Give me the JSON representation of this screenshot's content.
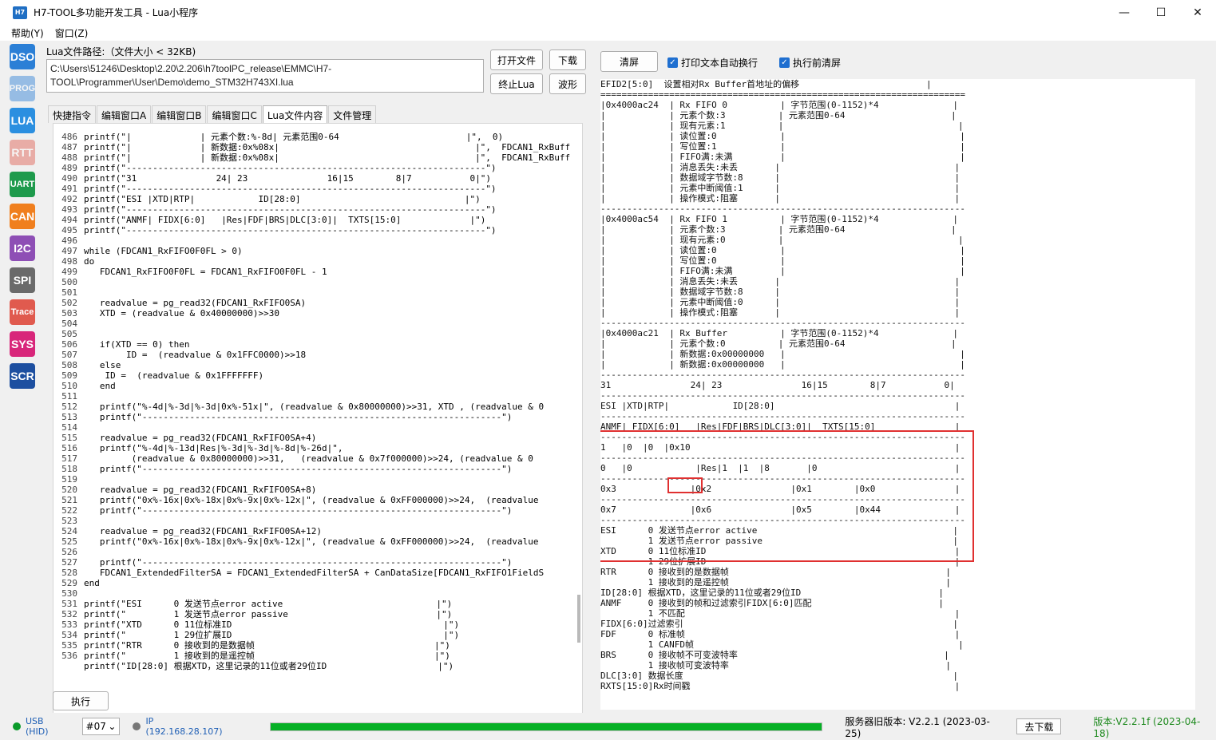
{
  "window": {
    "title": "H7-TOOL多功能开发工具 - Lua小程序",
    "logo": "H7"
  },
  "menu": [
    "帮助(Y)",
    "窗口(Z)"
  ],
  "sidebar": [
    {
      "label": "DSO",
      "color": "#2b7fd6",
      "dim": false
    },
    {
      "label": "PROG",
      "color": "#2b7fd6",
      "dim": true
    },
    {
      "label": "LUA",
      "color": "#2b8fe0",
      "dim": false
    },
    {
      "label": "RTT",
      "color": "#e05a4e",
      "dim": true
    },
    {
      "label": "UART",
      "color": "#1e9a4c",
      "dim": false
    },
    {
      "label": "CAN",
      "color": "#f07f1e",
      "dim": false
    },
    {
      "label": "I2C",
      "color": "#8e4fb5",
      "dim": false
    },
    {
      "label": "SPI",
      "color": "#6a6a6a",
      "dim": false
    },
    {
      "label": "Trace",
      "color": "#e05a4e",
      "dim": false
    },
    {
      "label": "SYS",
      "color": "#d8267a",
      "dim": false
    },
    {
      "label": "SCR",
      "color": "#1d4fa0",
      "dim": false
    }
  ],
  "left": {
    "path_label": "Lua文件路径:（文件大小 < 32KB)",
    "path_value": "C:\\Users\\51246\\Desktop\\2.20\\2.206\\h7toolPC_release\\EMMC\\H7-TOOL\\Programmer\\User\\Demo\\demo_STM32H743XI.lua",
    "buttons": {
      "open": "打开文件",
      "download": "下载",
      "stop": "终止Lua",
      "wave": "波形"
    },
    "tabs": [
      "快捷指令",
      "编辑窗口A",
      "编辑窗口B",
      "编辑窗口C",
      "Lua文件内容",
      "文件管理"
    ],
    "active_tab": 4,
    "execute": "执行",
    "code": [
      [
        "486",
        "printf(\"|             | 元素个数:%-8d| 元素范围0-64                        |\",  0)"
      ],
      [
        "487",
        "printf(\"|             | 新数据:0x%08x|                                     |\",  FDCAN1_RxBuff"
      ],
      [
        "488",
        "printf(\"|             | 新数据:0x%08x|                                     |\",  FDCAN1_RxBuff"
      ],
      [
        "489",
        "printf(\"--------------------------------------------------------------------\")"
      ],
      [
        "490",
        "printf(\"31               24| 23               16|15        8|7           0|\")"
      ],
      [
        "491",
        "printf(\"--------------------------------------------------------------------\")"
      ],
      [
        "492",
        "printf(\"ESI |XTD|RTP|            ID[28:0]                               |\")"
      ],
      [
        "493",
        "printf(\"--------------------------------------------------------------------\")"
      ],
      [
        "494",
        "printf(\"ANMF| FIDX[6:0]   |Res|FDF|BRS|DLC[3:0]|  TXTS[15:0]             |\")"
      ],
      [
        "495",
        "printf(\"--------------------------------------------------------------------\")"
      ],
      [
        "496",
        ""
      ],
      [
        "497",
        "while (FDCAN1_RxFIFO0F0FL > 0)"
      ],
      [
        "498",
        "do"
      ],
      [
        "499",
        "   FDCAN1_RxFIFO0F0FL = FDCAN1_RxFIFO0F0FL - 1"
      ],
      [
        "500",
        ""
      ],
      [
        "501",
        ""
      ],
      [
        "502",
        "   readvalue = pg_read32(FDCAN1_RxFIFO0SA)"
      ],
      [
        "503",
        "   XTD = (readvalue & 0x40000000)>>30"
      ],
      [
        "504",
        ""
      ],
      [
        "505",
        ""
      ],
      [
        "506",
        "   if(XTD == 0) then"
      ],
      [
        "507",
        "        ID =  (readvalue & 0x1FFC0000)>>18"
      ],
      [
        "508",
        "   else"
      ],
      [
        "509",
        "    ID =  (readvalue & 0x1FFFFFFF)"
      ],
      [
        "510",
        "   end"
      ],
      [
        "511",
        ""
      ],
      [
        "512",
        "   printf(\"%-4d|%-3d|%-3d|0x%-51x|\", (readvalue & 0x80000000)>>31, XTD , (readvalue & 0"
      ],
      [
        "513",
        "   printf(\"--------------------------------------------------------------------\")"
      ],
      [
        "514",
        ""
      ],
      [
        "515",
        "   readvalue = pg_read32(FDCAN1_RxFIFO0SA+4)"
      ],
      [
        "516",
        "   printf(\"%-4d|%-13d|Res|%-3d|%-3d|%-8d|%-26d|\","
      ],
      [
        "517",
        "         (readvalue & 0x80000000)>>31,   (readvalue & 0x7f000000)>>24, (readvalue & 0"
      ],
      [
        "518",
        "   printf(\"--------------------------------------------------------------------\")"
      ],
      [
        "519",
        ""
      ],
      [
        "520",
        "   readvalue = pg_read32(FDCAN1_RxFIFO0SA+8)"
      ],
      [
        "521",
        "   printf(\"0x%-16x|0x%-18x|0x%-9x|0x%-12x|\", (readvalue & 0xFF000000)>>24,  (readvalue"
      ],
      [
        "522",
        "   printf(\"--------------------------------------------------------------------\")"
      ],
      [
        "523",
        ""
      ],
      [
        "524",
        "   readvalue = pg_read32(FDCAN1_RxFIFO0SA+12)"
      ],
      [
        "525",
        "   printf(\"0x%-16x|0x%-18x|0x%-9x|0x%-12x|\", (readvalue & 0xFF000000)>>24,  (readvalue"
      ],
      [
        "526",
        ""
      ],
      [
        "527",
        "   printf(\"--------------------------------------------------------------------\")"
      ],
      [
        "528",
        "   FDCAN1_ExtendedFilterSA = FDCAN1_ExtendedFilterSA + CanDataSize[FDCAN1_RxFIFO1FieldS"
      ],
      [
        "529",
        "end"
      ],
      [
        "530",
        ""
      ],
      [
        "531",
        "printf(\"ESI      0 发送节点error active                             |\")"
      ],
      [
        "532",
        "printf(\"         1 发送节点error passive                            |\")"
      ],
      [
        "533",
        "printf(\"XTD      0 11位标准ID                                        |\")"
      ],
      [
        "534",
        "printf(\"         1 29位扩展ID                                        |\")"
      ],
      [
        "535",
        "printf(\"RTR      0 接收到的是数据帧                                  |\")"
      ],
      [
        "536",
        "printf(\"         1 接收到的是遥控帧                                  |\")"
      ],
      [
        "",
        "printf(\"ID[28:0] 根据XTD，这里记录的11位或者29位ID                     |\")"
      ]
    ]
  },
  "right": {
    "clear": "清屏",
    "wrap_label": "打印文本自动换行",
    "clear_before_label": "执行前清屏",
    "output": [
      "EFID2[5:0]  设置相对Rx Buffer首地址的偏移                        |",
      "=====================================================================",
      "|0x4000ac24  | Rx FIFO 0          | 字节范围(0-1152)*4              |",
      "|            | 元素个数:3          | 元素范围0-64                    |",
      "|            | 现有元素:1          |                                 |",
      "|            | 读位置:0            |                                 |",
      "|            | 写位置:1            |                                 |",
      "|            | FIFO满:未满         |                                 |",
      "|            | 消息丢失:未丢       |                                 |",
      "|            | 数据域字节数:8      |                                 |",
      "|            | 元素中断阈值:1      |                                 |",
      "|            | 操作模式:阻塞       |                                 |",
      "---------------------------------------------------------------------",
      "|0x4000ac54  | Rx FIFO 1          | 字节范围(0-1152)*4              |",
      "|            | 元素个数:3          | 元素范围0-64                    |",
      "|            | 现有元素:0          |                                 |",
      "|            | 读位置:0            |                                 |",
      "|            | 写位置:0            |                                 |",
      "|            | FIFO满:未满         |                                 |",
      "|            | 消息丢失:未丢       |                                 |",
      "|            | 数据域字节数:8      |                                 |",
      "|            | 元素中断阈值:0      |                                 |",
      "|            | 操作模式:阻塞       |                                 |",
      "---------------------------------------------------------------------",
      "|0x4000ac21  | Rx Buffer          | 字节范围(0-1152)*4              |",
      "|            | 元素个数:0          | 元素范围0-64                    |",
      "|            | 新数据:0x00000000   |                                 |",
      "|            | 新数据:0x00000000   |                                 |",
      "---------------------------------------------------------------------",
      "31               24| 23               16|15        8|7           0|",
      "---------------------------------------------------------------------",
      "ESI |XTD|RTP|            ID[28:0]                                  |",
      "---------------------------------------------------------------------",
      "ANMF| FIDX[6:0]   |Res|FDF|BRS|DLC[3:0]|  TXTS[15:0]               |",
      "---------------------------------------------------------------------",
      "1   |0  |0  |0x10                                                  |",
      "---------------------------------------------------------------------",
      "0   |0            |Res|1  |1  |8       |0                          |",
      "---------------------------------------------------------------------",
      "0x3              |0x2               |0x1        |0x0               |",
      "---------------------------------------------------------------------",
      "0x7              |0x6               |0x5        |0x44              |",
      "---------------------------------------------------------------------",
      "ESI      0 发送节点error active                                     |",
      "         1 发送节点error passive                                    |",
      "XTD      0 11位标准ID                                               |",
      "         1 29位扩展ID                                               |",
      "RTR      0 接收到的是数据帧                                         |",
      "         1 接收到的是遥控帧                                         |",
      "ID[28:0] 根据XTD，这里记录的11位或者29位ID                          |",
      "ANMF     0 接收到的帧和过滤索引FIDX[6:0]匹配                        |",
      "         1 不匹配                                                   |",
      "FIDX[6:0]过滤索引                                                   |",
      "FDF      0 标准帧                                                   |",
      "         1 CANFD帧                                                  |",
      "BRS      0 接收帧不可变波特率                                       |",
      "         1 接收帧可变波特率                                         |",
      "DLC[3:0] 数据长度                                                   |",
      "RXTS[15:0]Rx时间戳                                                  |"
    ]
  },
  "status": {
    "usb": "USB (HID)",
    "device": "#07",
    "ip": "IP (192.168.28.107)",
    "progress": 1.0,
    "server_version": "服务器旧版本: V2.2.1 (2023-03-25)",
    "download": "去下载",
    "version": "版本:V2.2.1f (2023-04-18)"
  }
}
